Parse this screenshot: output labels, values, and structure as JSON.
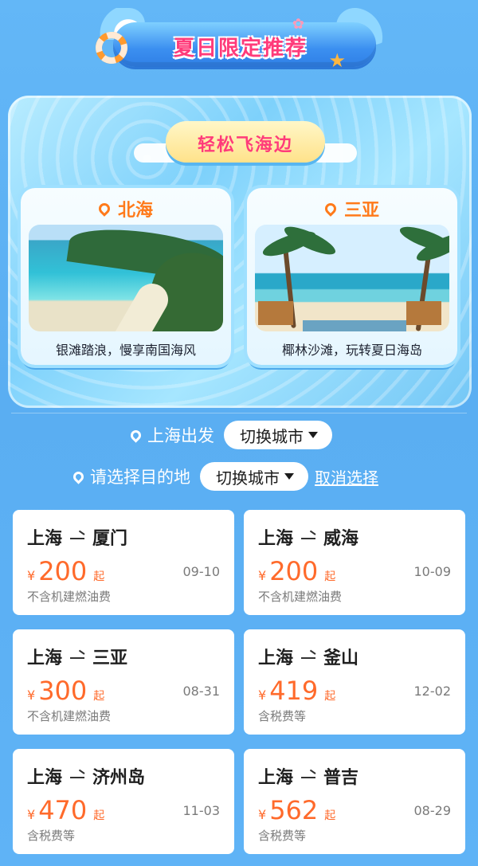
{
  "banner": {
    "title": "夏日限定推荐"
  },
  "panel": {
    "subtitle": "轻松飞海边",
    "destinations": [
      {
        "city": "北海",
        "caption": "银滩踏浪，慢享南国海风"
      },
      {
        "city": "三亚",
        "caption": "椰林沙滩，玩转夏日海岛"
      }
    ]
  },
  "filters": {
    "departure_text": "上海出发",
    "switch_label": "切换城市",
    "destination_prompt": "请选择目的地",
    "switch_label_2": "切换城市",
    "cancel_label": "取消选择"
  },
  "flights": [
    {
      "from": "上海",
      "to": "厦门",
      "currency": "¥",
      "price": "200",
      "suffix": "起",
      "date": "09-10",
      "note": "不含机建燃油费"
    },
    {
      "from": "上海",
      "to": "威海",
      "currency": "¥",
      "price": "200",
      "suffix": "起",
      "date": "10-09",
      "note": "不含机建燃油费"
    },
    {
      "from": "上海",
      "to": "三亚",
      "currency": "¥",
      "price": "300",
      "suffix": "起",
      "date": "08-31",
      "note": "不含机建燃油费"
    },
    {
      "from": "上海",
      "to": "釜山",
      "currency": "¥",
      "price": "419",
      "suffix": "起",
      "date": "12-02",
      "note": "含税费等"
    },
    {
      "from": "上海",
      "to": "济州岛",
      "currency": "¥",
      "price": "470",
      "suffix": "起",
      "date": "11-03",
      "note": "含税费等"
    },
    {
      "from": "上海",
      "to": "普吉",
      "currency": "¥",
      "price": "562",
      "suffix": "起",
      "date": "08-29",
      "note": "含税费等"
    }
  ],
  "colors": {
    "background": "#5fb4f5",
    "price": "#ff6a2b",
    "title_pink": "#ff3b7a",
    "dest_orange": "#ff7a1a"
  }
}
